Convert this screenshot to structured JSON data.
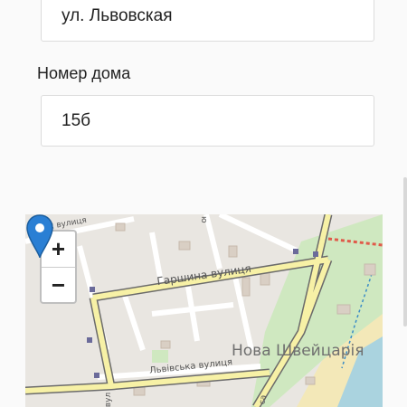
{
  "form": {
    "street_value": "ул. Львовская",
    "house_label": "Номер дома",
    "house_value": "15б"
  },
  "map": {
    "zoom_in_label": "+",
    "zoom_out_label": "−",
    "street_garshina": "Гаршина вулиця",
    "street_lvivska": "Львівська вулиця",
    "district_label": "Нова Швейцарія",
    "street_top": "Ах вулиця",
    "street_vertical": "ю",
    "street_bottom_left": "вул",
    "street_bottom_right": "ca",
    "marker_color": "#2a7fd4",
    "road_color": "#f7f1a6",
    "road_border": "#6b6b6b",
    "green_color": "#cfe8c0",
    "water_color": "#aad3df"
  }
}
